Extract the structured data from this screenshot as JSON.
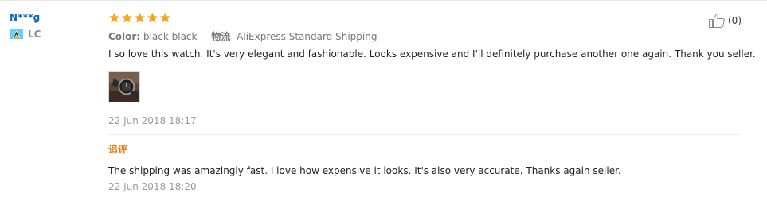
{
  "buyer": {
    "name": "N***g",
    "country_code": "LC",
    "flag_icon": "saint-lucia-flag-icon"
  },
  "review": {
    "rating": 5,
    "rating_max": 5,
    "star_color": "#f6a623",
    "color_label": "Color:",
    "color_value": "black black",
    "logistics_label": "物流",
    "logistics_value": "AliExpress Standard Shipping",
    "text": "I so love this watch. It's very elegant and fashionable. Looks expensive and I'll definitely purchase another one again. Thank you seller.",
    "photo_icon": "watch-photo-thumbnail",
    "date": "22 Jun 2018 18:17"
  },
  "followup": {
    "heading": "追评",
    "text": "The shipping was amazingly fast. I love how expensive it looks. It's also very accurate. Thanks again seller.",
    "date": "22 Jun 2018 18:20"
  },
  "helpful": {
    "icon": "thumbs-up-icon",
    "count_text": "(0)"
  },
  "colors": {
    "buyer_name": "#0a67c7",
    "followup_heading": "#e97c19",
    "muted_text": "#9a9a9a"
  }
}
